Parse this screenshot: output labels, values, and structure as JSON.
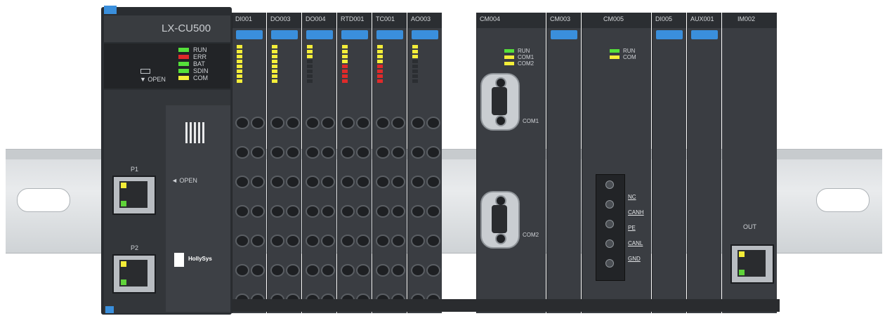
{
  "cpu": {
    "title": "LX-CU500",
    "leds": [
      {
        "label": "RUN",
        "color": "#55e03a"
      },
      {
        "label": "ERR",
        "color": "#e02a2a"
      },
      {
        "label": "BAT",
        "color": "#55e03a"
      },
      {
        "label": "SDIN",
        "color": "#55e03a"
      },
      {
        "label": "COM",
        "color": "#f4ee39"
      }
    ],
    "open_label": "▼ OPEN",
    "side_open_label": "◄ OPEN",
    "port1_label": "P1",
    "port2_label": "P2",
    "logo_text": "HollySys"
  },
  "modules": [
    {
      "label": "DI001",
      "leds": [
        "#f4ee39",
        "#f4ee39",
        "#f4ee39",
        "#f4ee39",
        "#f4ee39",
        "#f4ee39",
        "#f4ee39",
        "#f4ee39"
      ]
    },
    {
      "label": "DO003",
      "leds": [
        "#f4ee39",
        "#f4ee39",
        "#f4ee39",
        "#f4ee39",
        "#f4ee39",
        "#f4ee39",
        "#f4ee39",
        "#f4ee39"
      ]
    },
    {
      "label": "DO004",
      "leds": [
        "#f4ee39",
        "#f4ee39",
        "#f4ee39",
        "#2b2e32",
        "#2b2e32",
        "#2b2e32",
        "#2b2e32",
        "#2b2e32"
      ]
    },
    {
      "label": "RTD001",
      "leds": [
        "#f4ee39",
        "#f4ee39",
        "#f4ee39",
        "#f4ee39",
        "#e02a2a",
        "#e02a2a",
        "#e02a2a",
        "#e02a2a"
      ]
    },
    {
      "label": "TC001",
      "leds": [
        "#f4ee39",
        "#f4ee39",
        "#f4ee39",
        "#f4ee39",
        "#e02a2a",
        "#e02a2a",
        "#e02a2a",
        "#e02a2a"
      ]
    },
    {
      "label": "AO003",
      "leds": [
        "#f4ee39",
        "#f4ee39",
        "#f4ee39",
        "#2b2e32",
        "#2b2e32",
        "#2b2e32",
        "#2b2e32",
        "#2b2e32"
      ]
    }
  ],
  "cm004": {
    "label": "CM004",
    "leds": [
      {
        "label": "RUN",
        "color": "#55e03a"
      },
      {
        "label": "COM1",
        "color": "#f4ee39"
      },
      {
        "label": "COM2",
        "color": "#f4ee39"
      }
    ],
    "com1": "COM1",
    "com2": "COM2"
  },
  "cm003": {
    "label": "CM003"
  },
  "cm005": {
    "label": "CM005",
    "leds": [
      {
        "label": "RUN",
        "color": "#55e03a"
      },
      {
        "label": "COM",
        "color": "#f4ee39"
      }
    ],
    "can_labels": [
      "NC",
      "CANH",
      "PE",
      "CANL",
      "GND"
    ]
  },
  "di005": {
    "label": "DI005"
  },
  "aux001": {
    "label": "AUX001"
  },
  "im002": {
    "label": "IM002",
    "out_label": "OUT"
  }
}
